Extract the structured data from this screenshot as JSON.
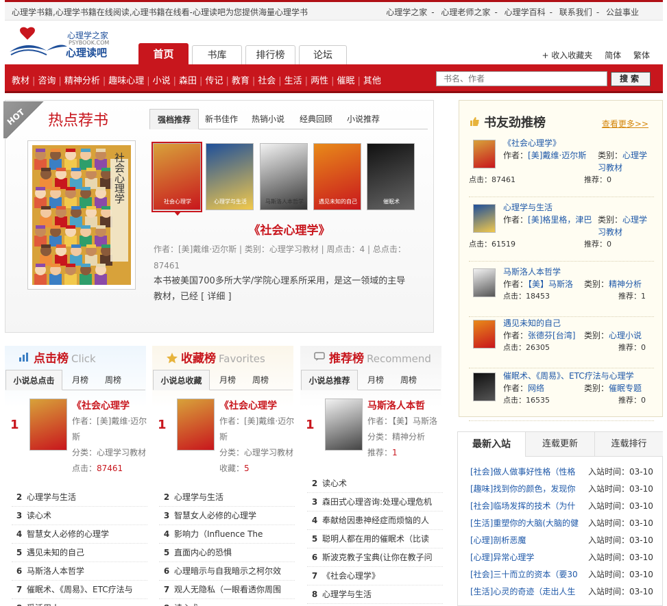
{
  "topbar": {
    "slogan": "心理学书籍,心理学书籍在线阅读,心理书籍在线看-心理读吧为您提供海量心理学书",
    "links": [
      "心理学之家",
      "心理老师之家",
      "心理学百科",
      "联系我们",
      "公益事业"
    ],
    "sep": "-"
  },
  "logo": {
    "line1": "心理学之家",
    "line2": "PSYBOOK.COM",
    "line3": "心理读吧"
  },
  "tabs": [
    "首页",
    "书库",
    "排行榜",
    "论坛"
  ],
  "toplinks": [
    "+ 收入收藏夹",
    "简体",
    "繁体"
  ],
  "nav": {
    "items": [
      "教材",
      "咨询",
      "精神分析",
      "趣味心理",
      "小说",
      "森田",
      "传记",
      "教育",
      "社会",
      "生活",
      "两性",
      "催眠",
      "其他"
    ],
    "sep": "|",
    "search_placeholder": "书名、作者",
    "search_button": "搜索"
  },
  "hot": {
    "ribbon": "HOT",
    "title": "热点荐书",
    "tabs": [
      "强档推荐",
      "新书佳作",
      "热销小说",
      "经典回顾",
      "小说推荐"
    ],
    "book_name": "《社会心理学》",
    "meta": "作者：[美]戴维·迈尔斯 | 类别：心理学习教材 | 周点击：4 | 总点击：87461",
    "desc": "本书被美国700多所大学/学院心理系所采用，是这一领域的主导教材，已经 [ 详细 ]",
    "cover_spine": "社会心理学",
    "mini_covers": [
      "社会心理学",
      "心理学与生活",
      "马斯洛人本哲学",
      "遇见未知的自己",
      "催眠术"
    ]
  },
  "rankings": [
    {
      "title": "点击榜",
      "en": "Click",
      "tabs": [
        "小说总点击",
        "月榜",
        "周榜"
      ],
      "top": {
        "num": "1",
        "name": "《社会心理学",
        "author": "作者：[美]戴维·迈尔斯",
        "cat": "分类：心理学习教材",
        "stat_label": "点击：",
        "stat": "87461"
      },
      "list": [
        {
          "n": "2",
          "t": "心理学与生活"
        },
        {
          "n": "3",
          "t": "读心术"
        },
        {
          "n": "4",
          "t": "智慧女人必修的心理学"
        },
        {
          "n": "5",
          "t": "遇见未知的自己"
        },
        {
          "n": "6",
          "t": "马斯洛人本哲学"
        },
        {
          "n": "7",
          "t": "催眠术、《周易》、ETC疗法与"
        },
        {
          "n": "8",
          "t": "受活用人"
        }
      ]
    },
    {
      "title": "收藏榜",
      "en": "Favorites",
      "tabs": [
        "小说总收藏",
        "月榜",
        "周榜"
      ],
      "top": {
        "num": "1",
        "name": "《社会心理学",
        "author": "作者：[美]戴维·迈尔斯",
        "cat": "分类：心理学习教材",
        "stat_label": "收藏：",
        "stat": "5"
      },
      "list": [
        {
          "n": "2",
          "t": "心理学与生活"
        },
        {
          "n": "3",
          "t": "智慧女人必修的心理学"
        },
        {
          "n": "4",
          "t": "影响力（Influence The"
        },
        {
          "n": "5",
          "t": "直面内心的恐惧"
        },
        {
          "n": "6",
          "t": "心理暗示与自我暗示之柯尔效"
        },
        {
          "n": "7",
          "t": "观人无隐私（一眼看透你周围"
        },
        {
          "n": "8",
          "t": "读心术"
        }
      ]
    },
    {
      "title": "推荐榜",
      "en": "Recommend",
      "tabs": [
        "小说总推荐",
        "月榜",
        "周榜"
      ],
      "top": {
        "num": "1",
        "name": "马斯洛人本哲",
        "author": "作者：【美】马斯洛",
        "cat": "分类：精神分析",
        "stat_label": "推荐：",
        "stat": "1"
      },
      "list": [
        {
          "n": "2",
          "t": "读心术"
        },
        {
          "n": "3",
          "t": "森田式心理咨询:处理心理危机"
        },
        {
          "n": "4",
          "t": "奉献给因患神经症而烦恼的人"
        },
        {
          "n": "5",
          "t": "聪明人都在用的催眠术（比读"
        },
        {
          "n": "6",
          "t": "斯波克教子宝典(让你在教子问"
        },
        {
          "n": "7",
          "t": "《社会心理学》"
        },
        {
          "n": "8",
          "t": "心理学与生活"
        }
      ]
    }
  ],
  "friend": {
    "title": "书友劲推榜",
    "more": "查看更多>>",
    "items": [
      {
        "name": "《社会心理学》",
        "author_label": "作者：",
        "author": "[美]戴维·迈尔斯",
        "cat_label": "类别：",
        "cat": "心理学习教材",
        "hits": "点击：87461",
        "rec": "推荐：0"
      },
      {
        "name": "心理学与生活",
        "author_label": "作者：",
        "author": "[美]格里格，津巴",
        "cat_label": "类别：",
        "cat": "心理学习教材",
        "hits": "点击：61519",
        "rec": "推荐：0"
      },
      {
        "name": "马斯洛人本哲学",
        "author_label": "作者：",
        "author": "【美】马斯洛",
        "cat_label": "类别：",
        "cat": "精神分析",
        "hits": "点击：18453",
        "rec": "推荐：1"
      },
      {
        "name": "遇见未知的自己",
        "author_label": "作者：",
        "author": "张德芬[台湾]",
        "cat_label": "类别：",
        "cat": "心理小说",
        "hits": "点击：26305",
        "rec": "推荐：0"
      },
      {
        "name": "催眠术、《周易》、ETC疗法与心理学",
        "author_label": "作者：",
        "author": "网络",
        "cat_label": "类别：",
        "cat": "催眠专题",
        "hits": "点击：16535",
        "rec": "推荐：0"
      }
    ]
  },
  "newbox": {
    "tabs": [
      "最新入站",
      "连载更新",
      "连载排行"
    ],
    "time_label": "入站时间：",
    "rows": [
      {
        "cat": "[社会]",
        "t": "做人做事好性格（性格",
        "d": "03-10"
      },
      {
        "cat": "[趣味]",
        "t": "找到你的颜色，发现你",
        "d": "03-10"
      },
      {
        "cat": "[社会]",
        "t": "临场发挥的技术（为什",
        "d": "03-10"
      },
      {
        "cat": "[生活]",
        "t": "重塑你的大脑(大脑的健",
        "d": "03-10"
      },
      {
        "cat": "[心理]",
        "t": "剖析恶魔",
        "d": "03-10"
      },
      {
        "cat": "[心理]",
        "t": "异常心理学",
        "d": "03-10"
      },
      {
        "cat": "[社会]",
        "t": "三十而立的资本（要30",
        "d": "03-10"
      },
      {
        "cat": "[生活]",
        "t": "心灵的奇迹（走出人生",
        "d": "03-10"
      }
    ]
  },
  "colors": {
    "brand_red": "#c8161d",
    "link_blue": "#1e58a8",
    "accent_orange": "#d4860c"
  }
}
